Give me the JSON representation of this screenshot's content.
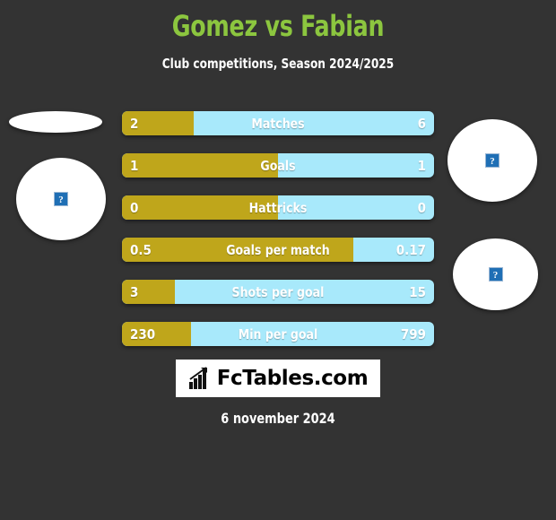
{
  "header": {
    "title": "Gomez vs Fabian",
    "subtitle": "Club competitions, Season 2024/2025",
    "title_color": "#8CC63F",
    "subtitle_color": "#FFFFFF"
  },
  "theme": {
    "background": "#333333",
    "home_color": "#BFA61B",
    "away_color": "#A8E9FB",
    "text_color": "#FFFFFF"
  },
  "players": {
    "home": {
      "photo_alt": "?"
    },
    "away": {
      "photo_alt": "?"
    },
    "extra_left": {
      "photo_alt": "?"
    },
    "extra_right": {
      "photo_alt": "?"
    }
  },
  "chart_data": {
    "type": "bar",
    "title": "Gomez vs Fabian",
    "subtitle": "Club competitions, Season 2024/2025",
    "orientation": "horizontal-diverging",
    "categories": [
      "Matches",
      "Goals",
      "Hattricks",
      "Goals per match",
      "Shots per goal",
      "Min per goal"
    ],
    "series": [
      {
        "name": "Gomez",
        "color": "#BFA61B",
        "side": "left",
        "values": [
          2,
          1,
          0,
          0.5,
          3,
          230
        ],
        "labels": [
          "2",
          "1",
          "0",
          "0.5",
          "3",
          "230"
        ]
      },
      {
        "name": "Fabian",
        "color": "#A8E9FB",
        "side": "right",
        "values": [
          6,
          1,
          0,
          0.17,
          15,
          799
        ],
        "labels": [
          "6",
          "1",
          "0",
          "0.17",
          "15",
          "799"
        ]
      }
    ],
    "rows": [
      {
        "label": "Matches",
        "home": "2",
        "away": "6",
        "home_pct": 23
      },
      {
        "label": "Goals",
        "home": "1",
        "away": "1",
        "home_pct": 50
      },
      {
        "label": "Hattricks",
        "home": "0",
        "away": "0",
        "home_pct": 50
      },
      {
        "label": "Goals per match",
        "home": "0.5",
        "away": "0.17",
        "home_pct": 74
      },
      {
        "label": "Shots per goal",
        "home": "3",
        "away": "15",
        "home_pct": 17
      },
      {
        "label": "Min per goal",
        "home": "230",
        "away": "799",
        "home_pct": 22
      }
    ],
    "grid": false,
    "legend": "none"
  },
  "footer": {
    "logo_text": "FcTables.com",
    "logo_icon": "bar-chart-arrow-icon",
    "date": "6 november 2024"
  }
}
